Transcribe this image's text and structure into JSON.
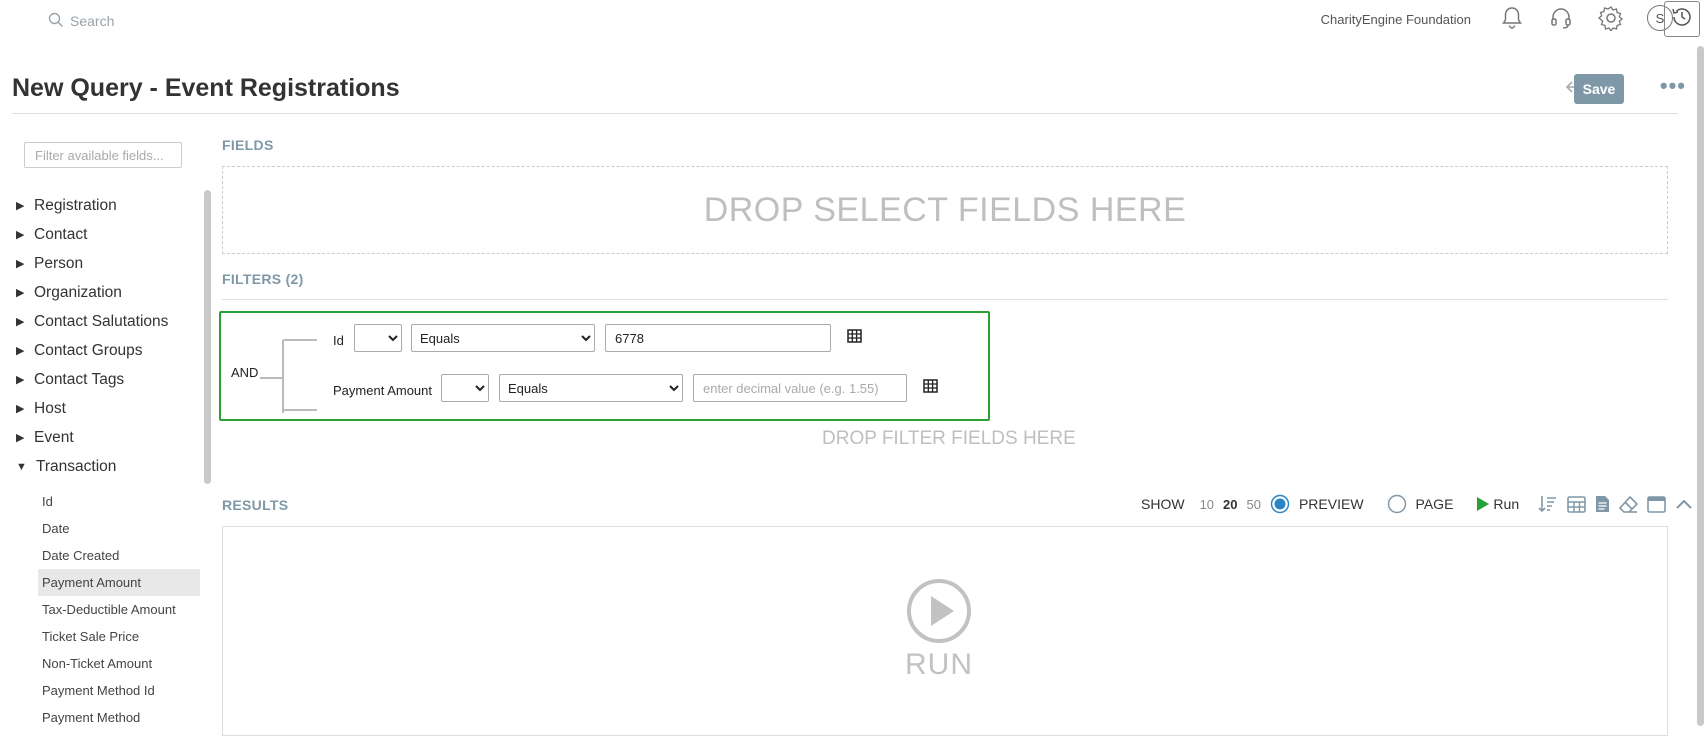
{
  "topbar": {
    "search_placeholder": "Search",
    "org_name": "CharityEngine Foundation",
    "avatar_letter": "S"
  },
  "header": {
    "title": "New Query - Event Registrations",
    "save_label": "Save"
  },
  "sidebar": {
    "filter_placeholder": "Filter available fields...",
    "groups": [
      "Registration",
      "Contact",
      "Person",
      "Organization",
      "Contact Salutations",
      "Contact Groups",
      "Contact Tags",
      "Host",
      "Event",
      "Transaction"
    ],
    "expanded_group": "Transaction",
    "transaction_fields": [
      "Id",
      "Date",
      "Date Created",
      "Payment Amount",
      "Tax-Deductible Amount",
      "Ticket Sale Price",
      "Non-Ticket Amount",
      "Payment Method Id",
      "Payment Method"
    ],
    "selected_field": "Payment Amount"
  },
  "fields_section": {
    "heading": "FIELDS",
    "drop_text": "DROP SELECT FIELDS HERE"
  },
  "filters_section": {
    "heading": "FILTERS (2)",
    "logic": "AND",
    "rows": [
      {
        "field": "Id",
        "operator": "Equals",
        "value": "6778",
        "placeholder": ""
      },
      {
        "field": "Payment Amount",
        "operator": "Equals",
        "value": "",
        "placeholder": "enter decimal value (e.g. 1.55)"
      }
    ],
    "drop_text": "DROP FILTER FIELDS HERE"
  },
  "results_section": {
    "heading": "RESULTS",
    "show_label": "SHOW",
    "page_sizes": [
      "10",
      "20",
      "50"
    ],
    "selected_page_size": "20",
    "mode_preview": "PREVIEW",
    "mode_page": "PAGE",
    "selected_mode": "PREVIEW",
    "run_label": "Run",
    "run_big_label": "RUN"
  },
  "colors": {
    "accent": "#7f98a8",
    "highlight_border": "#2aa134",
    "run_green": "#2aa134",
    "radio_selected": "#2b84c6"
  }
}
